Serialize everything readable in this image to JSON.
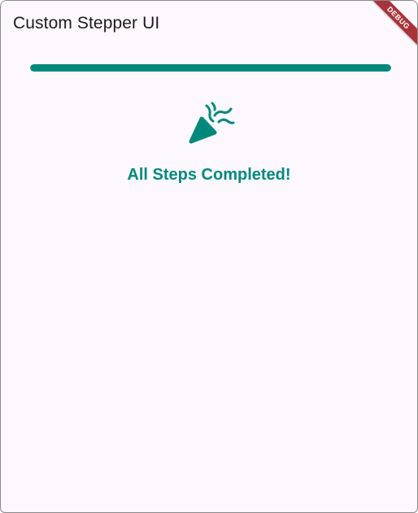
{
  "app_bar": {
    "title": "Custom Stepper UI"
  },
  "progress": {
    "value": 1.0
  },
  "completion": {
    "icon": "celebration-icon",
    "message": "All Steps Completed!"
  },
  "debug_banner": {
    "label": "DEBUG"
  },
  "colors": {
    "accent": "#00897b",
    "background": "#fdf7fe",
    "title_text": "#1f1b21",
    "debug_banner": "#a8343a"
  }
}
